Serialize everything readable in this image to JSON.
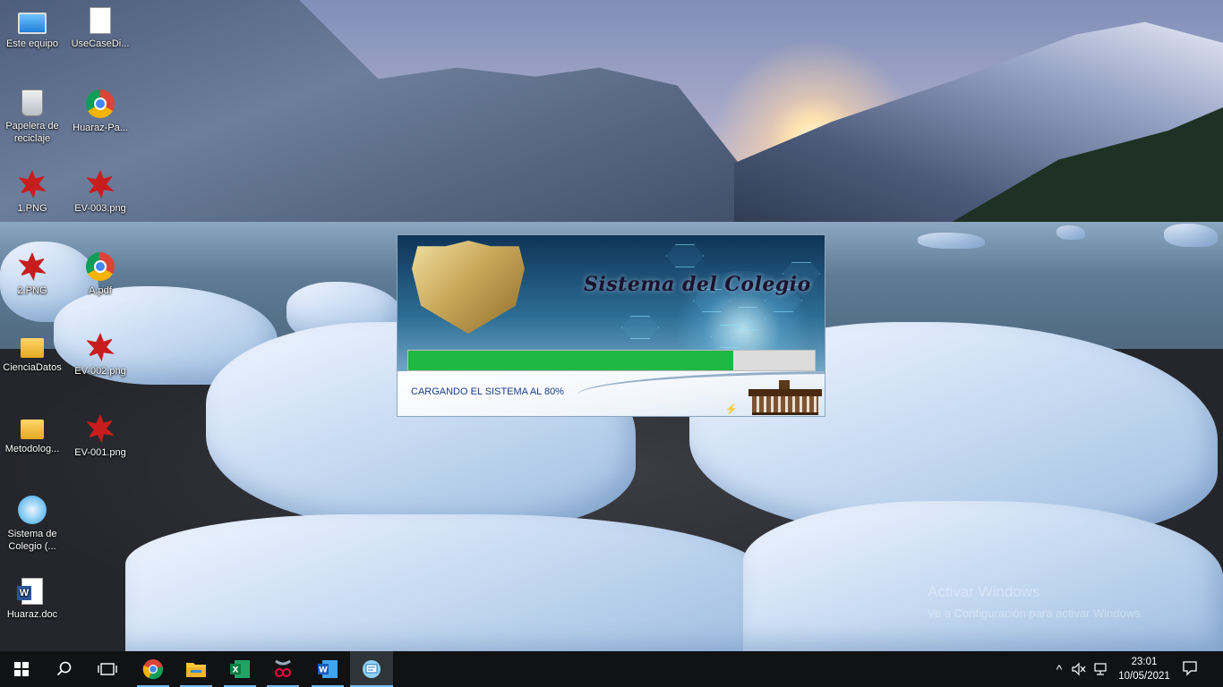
{
  "desktop": {
    "icons": [
      {
        "label": "Este equipo",
        "icon": "computer-icon"
      },
      {
        "label": "UseCaseDi...",
        "icon": "uml-file-icon"
      },
      {
        "label": "Papelera de reciclaje",
        "icon": "recycle-bin-icon"
      },
      {
        "label": "Huaraz-Pa...",
        "icon": "chrome-icon"
      },
      {
        "label": "1.PNG",
        "icon": "image-file-icon"
      },
      {
        "label": "EV-003.png",
        "icon": "image-file-icon"
      },
      {
        "label": "2.PNG",
        "icon": "image-file-icon"
      },
      {
        "label": "A.pdf",
        "icon": "chrome-icon"
      },
      {
        "label": "CienciaDatos",
        "icon": "folder-icon"
      },
      {
        "label": "EV-002.png",
        "icon": "image-file-icon"
      },
      {
        "label": "Metodolog...",
        "icon": "folder-icon"
      },
      {
        "label": "EV-001.png",
        "icon": "image-file-icon"
      },
      {
        "label": "Sistema de Colegio (...",
        "icon": "app-shortcut-icon"
      },
      {
        "label": "Huaraz.doc",
        "icon": "word-doc-icon"
      }
    ],
    "watermark": {
      "line1": "Activar Windows",
      "line2": "Ve a Configuración para activar Windows."
    }
  },
  "splash": {
    "title": "Sistema del Colegio",
    "progress_percent": 80,
    "loading_text": "CARGANDO EL SISTEMA AL 80%",
    "colors": {
      "progress": "#1fb843",
      "loading_text": "#1b3c8c"
    }
  },
  "taskbar": {
    "pinned": [
      {
        "name": "Inicio",
        "icon": "windows-start-icon"
      },
      {
        "name": "Buscar",
        "icon": "search-icon"
      },
      {
        "name": "Vista de tareas",
        "icon": "task-view-icon"
      },
      {
        "name": "Google Chrome",
        "icon": "chrome-icon"
      },
      {
        "name": "Explorador de archivos",
        "icon": "folder-icon"
      },
      {
        "name": "Excel",
        "icon": "excel-icon"
      },
      {
        "name": "Recortes",
        "icon": "snipping-tool-icon"
      },
      {
        "name": "Word",
        "icon": "word-icon"
      },
      {
        "name": "Sistema de Colegio",
        "icon": "app-shortcut-icon"
      }
    ],
    "time": "23:01",
    "date": "10/05/2021"
  }
}
